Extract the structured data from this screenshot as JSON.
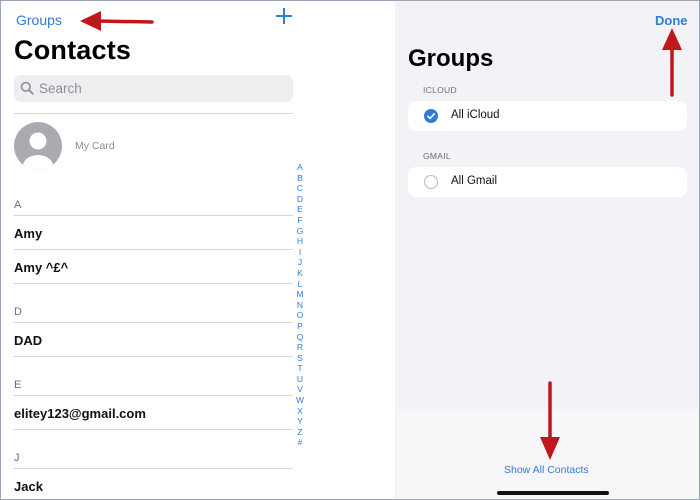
{
  "left_pane": {
    "nav_groups_label": "Groups",
    "title": "Contacts",
    "search": {
      "placeholder": "Search"
    },
    "my_card_label": "My Card",
    "sections": [
      {
        "letter": "A",
        "contacts": [
          "Amy",
          "Amy ^£^"
        ]
      },
      {
        "letter": "D",
        "contacts": [
          "DAD"
        ]
      },
      {
        "letter": "E",
        "contacts": [
          "elitey123@gmail.com"
        ]
      },
      {
        "letter": "J",
        "contacts": [
          "Jack"
        ]
      }
    ],
    "index_letters": [
      "A",
      "B",
      "C",
      "D",
      "E",
      "F",
      "G",
      "H",
      "I",
      "J",
      "K",
      "L",
      "M",
      "N",
      "O",
      "P",
      "Q",
      "R",
      "S",
      "T",
      "U",
      "V",
      "W",
      "X",
      "Y",
      "Z",
      "#"
    ]
  },
  "right_pane": {
    "done_label": "Done",
    "title": "Groups",
    "sections": [
      {
        "header": "ICLOUD",
        "item": {
          "label": "All iCloud",
          "checked": true
        }
      },
      {
        "header": "GMAIL",
        "item": {
          "label": "All Gmail",
          "checked": false
        }
      }
    ],
    "show_all_label": "Show All Contacts"
  },
  "colors": {
    "accent": "#2f7bd6",
    "annotation_arrow": "#c0171c"
  }
}
